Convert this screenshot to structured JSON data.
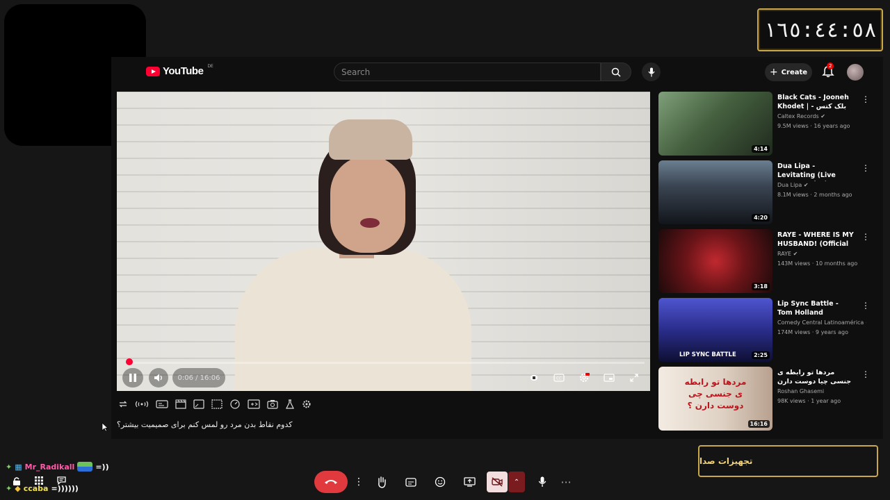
{
  "timer": {
    "display": "١٦٥:٤٤:٥٨"
  },
  "youtube": {
    "wordmark": "YouTube",
    "region": "DE",
    "search_placeholder": "Search",
    "create_label": "Create",
    "notification_count": "2"
  },
  "player": {
    "time": "0:06 / 16:06",
    "progress_fraction": 0.006,
    "caption": "کدوم نقاط بدن مرد رو لمس کنم برای صمیمیت بیشتر؟"
  },
  "recommendations": [
    {
      "title": "Black Cats - Jooneh Khodet | بلک کتس - جون ...",
      "channel": "Caltex Records",
      "verified": true,
      "meta": "9.5M views · 16 years ago",
      "duration": "4:14",
      "thumb_colors": [
        "#6d8a6a",
        "#2f3b2c"
      ]
    },
    {
      "title": "Dua Lipa - Levitating (Live From Mexico)",
      "channel": "Dua Lipa",
      "verified": true,
      "meta": "8.1M views · 2 months ago",
      "duration": "4:20",
      "thumb_colors": [
        "#5a6d7d",
        "#1b1f27"
      ]
    },
    {
      "title": "RAYE - WHERE IS MY HUSBAND! (Official ...",
      "channel": "RAYE",
      "verified": true,
      "meta": "143M views · 10 months ago",
      "duration": "3:18",
      "thumb_colors": [
        "#8e1f23",
        "#2a0f10"
      ]
    },
    {
      "title": "Lip Sync Battle - Tom Holland",
      "channel": "Comedy Central Latinoamérica",
      "verified": true,
      "meta": "174M views · 9 years ago",
      "duration": "2:25",
      "thumb_label": "LIP SYNC BATTLE",
      "thumb_colors": [
        "#3a3fae",
        "#141548"
      ]
    },
    {
      "title": "مردها تو رابطه ی جنسی چیا دوست دارن ؟",
      "channel": "Roshan Ghasemi",
      "verified": false,
      "meta": "98K views · 1 year ago",
      "duration": "16:16",
      "thumb_label": "مردها تو رابطه ی جنسی چی دوست دارن ؟",
      "thumb_colors": [
        "#f1e7dc",
        "#c9b8a6"
      ]
    }
  ],
  "chat": [
    {
      "user": "Mr_Radikall",
      "message": "=))"
    },
    {
      "user": "ccaba",
      "message": "=))))))"
    }
  ],
  "sound_settings_label": "تجهیزات صدا",
  "colors": {
    "accent": "#ff0033",
    "timer_border": "#c9a74b",
    "end_call": "#e03a3e"
  }
}
